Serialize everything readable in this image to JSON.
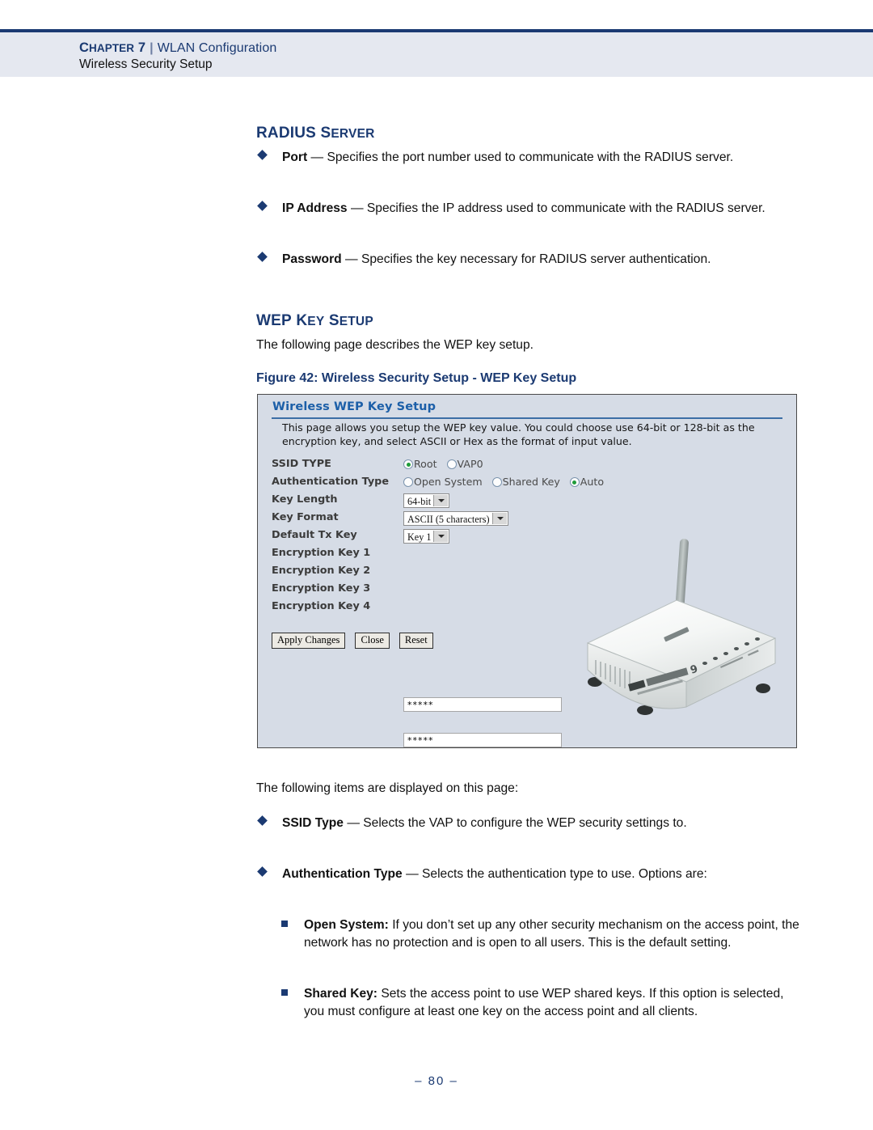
{
  "header": {
    "chapter_label": "CHAPTER",
    "chapter_number": "7",
    "separator": "|",
    "section": "WLAN Configuration",
    "subsection": "Wireless Security Setup"
  },
  "sections": {
    "radius": {
      "heading": "RADIUS SERVER",
      "items": [
        {
          "term": "Port",
          "dash": "—",
          "desc": "Specifies the port number used to communicate with the RADIUS server."
        },
        {
          "term": "IP Address",
          "dash": "—",
          "desc": "Specifies the IP address used to communicate with the RADIUS server."
        },
        {
          "term": "Password",
          "dash": "—",
          "desc": "Specifies the key necessary for RADIUS server authentication."
        }
      ]
    },
    "wep": {
      "heading": "WEP KEY SETUP",
      "intro": "The following page describes the WEP key setup.",
      "figure_caption": "Figure 42:  Wireless Security Setup - WEP Key Setup",
      "items_intro": "The following items are displayed on this page:",
      "items": [
        {
          "term": "SSID Type",
          "dash": "—",
          "desc": "Selects the VAP to configure the WEP security settings to."
        },
        {
          "term": "Authentication Type",
          "dash": "—",
          "desc": "Selects the authentication type to use. Options are:"
        }
      ],
      "subitems": [
        {
          "term": "Open System:",
          "desc": "If you don’t set up any other security mechanism on the access point, the network has no protection and is open to all users. This is the default setting."
        },
        {
          "term": "Shared Key:",
          "desc": "Sets the access point to use WEP shared keys. If this option is selected, you must configure at least one key on the access point and all clients."
        }
      ]
    }
  },
  "figure": {
    "title": "Wireless WEP Key Setup",
    "description": "This page allows you setup the WEP key value. You could choose use 64-bit or 128-bit as the encryption key, and select ASCII or Hex as the format of input value.",
    "rows": {
      "ssid_type": {
        "label": "SSID TYPE",
        "options": [
          {
            "label": "Root",
            "selected": true
          },
          {
            "label": "VAP0",
            "selected": false
          }
        ]
      },
      "auth_type": {
        "label": "Authentication Type",
        "options": [
          {
            "label": "Open System",
            "selected": false
          },
          {
            "label": "Shared Key",
            "selected": false
          },
          {
            "label": "Auto",
            "selected": true
          }
        ]
      },
      "key_length": {
        "label": "Key Length",
        "value": "64-bit"
      },
      "key_format": {
        "label": "Key Format",
        "value": "ASCII (5 characters)"
      },
      "default_tx_key": {
        "label": "Default Tx Key",
        "value": "Key 1"
      },
      "enc_key_1": {
        "label": "Encryption Key 1",
        "value": "*****"
      },
      "enc_key_2": {
        "label": "Encryption Key 2",
        "value": "*****"
      },
      "enc_key_3": {
        "label": "Encryption Key 3",
        "value": "*****"
      },
      "enc_key_4": {
        "label": "Encryption Key 4",
        "value": "*****"
      }
    },
    "buttons": {
      "apply": "Apply Changes",
      "close": "Close",
      "reset": "Reset"
    },
    "device_image": "wireless-router-photo"
  },
  "footer": {
    "page_number": "–  80  –"
  },
  "colors": {
    "brand_navy": "#1b3a72",
    "header_band": "#e5e8f0",
    "figure_bg": "#d6dce6",
    "figure_title": "#1c5fa8",
    "radio_selected": "#1f9c3a"
  }
}
